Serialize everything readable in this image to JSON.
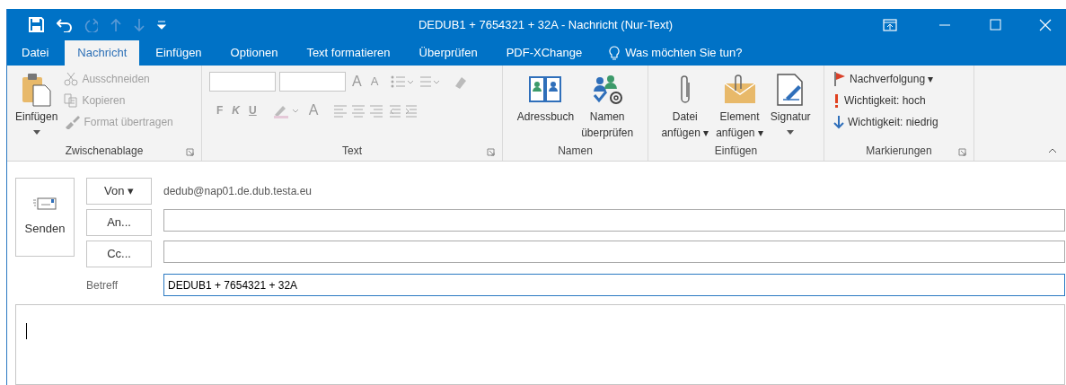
{
  "window": {
    "title": "DEDUB1 + 7654321 + 32A - Nachricht (Nur-Text)"
  },
  "quick_access": [
    {
      "kind": "save",
      "disabled": false
    },
    {
      "kind": "undo",
      "disabled": false
    },
    {
      "kind": "redo",
      "disabled": true
    },
    {
      "kind": "up",
      "disabled": true
    },
    {
      "kind": "down",
      "disabled": true
    },
    {
      "kind": "customize",
      "disabled": false
    }
  ],
  "tabs": [
    {
      "label": "Datei",
      "selected": false
    },
    {
      "label": "Nachricht",
      "selected": true
    },
    {
      "label": "Einfügen",
      "selected": false
    },
    {
      "label": "Optionen",
      "selected": false
    },
    {
      "label": "Text formatieren",
      "selected": false
    },
    {
      "label": "Überprüfen",
      "selected": false
    },
    {
      "label": "PDF-XChange",
      "selected": false
    }
  ],
  "tell_me": "Was möchten Sie tun?",
  "ribbon_groups": [
    {
      "kind": "clipboard",
      "label": "Zwischenablage",
      "items": [
        {
          "kind": "large",
          "lines": [
            "Einfügen"
          ]
        },
        {
          "kind": "small",
          "label": "Ausschneiden",
          "disabled": true
        },
        {
          "kind": "small",
          "label": "Kopieren",
          "disabled": true
        },
        {
          "kind": "small",
          "label": "Format übertragen",
          "disabled": true
        }
      ]
    },
    {
      "kind": "text",
      "label": "Text",
      "size_buttons": [
        "A",
        "A"
      ],
      "format_buttons": [
        "F",
        "K",
        "U"
      ],
      "font_color": "A"
    },
    {
      "kind": "buttons",
      "label": "Namen",
      "items": [
        {
          "kind": "large",
          "lines": [
            "Adressbuch"
          ]
        },
        {
          "kind": "large",
          "lines": [
            "Namen",
            "überprüfen"
          ]
        }
      ]
    },
    {
      "kind": "buttons",
      "label": "Einfügen",
      "items": [
        {
          "kind": "large",
          "lines": [
            "Datei",
            "anfügen ▾"
          ]
        },
        {
          "kind": "large",
          "lines": [
            "Element",
            "anfügen ▾"
          ]
        },
        {
          "kind": "large",
          "lines": [
            "Signatur"
          ]
        }
      ]
    },
    {
      "kind": "clipboard",
      "label": "Markierungen",
      "items": [
        {
          "kind": "small",
          "label": "Nachverfolgung ▾",
          "disabled": false
        },
        {
          "kind": "small",
          "label": "Wichtigkeit: hoch",
          "disabled": false
        },
        {
          "kind": "small",
          "label": "Wichtigkeit: niedrig",
          "disabled": false
        }
      ]
    }
  ],
  "compose": {
    "send": "Senden",
    "from_button": "Von ▾",
    "from_address": "dedub@nap01.de.dub.testa.eu",
    "to_button": "An...",
    "cc_button": "Cc...",
    "subject_label": "Betreff",
    "subject": "DEDUB1 + 7654321 + 32A"
  }
}
